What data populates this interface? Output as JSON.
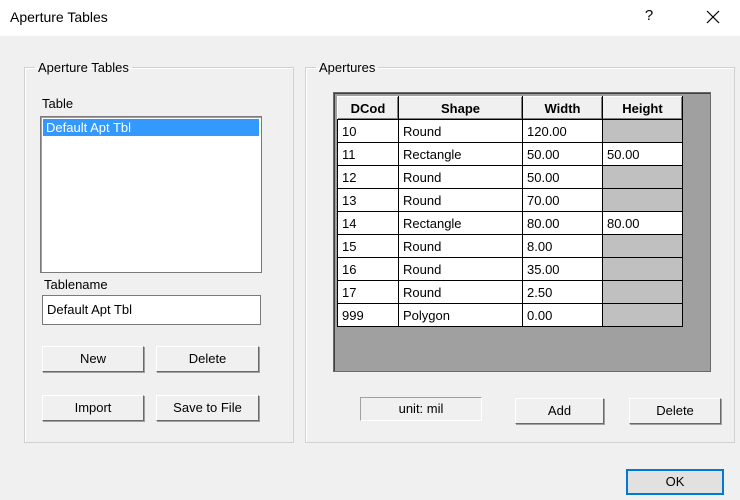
{
  "window": {
    "title": "Aperture Tables",
    "help_glyph": "?"
  },
  "left_group": {
    "legend": "Aperture Tables",
    "table_label": "Table",
    "tables": [
      "Default Apt Tbl"
    ],
    "tablename_label": "Tablename",
    "tablename_value": "Default Apt Tbl",
    "buttons": {
      "new": "New",
      "delete": "Delete",
      "import": "Import",
      "save": "Save to File"
    }
  },
  "right_group": {
    "legend": "Apertures",
    "columns": [
      "DCod",
      "Shape",
      "Width",
      "Height"
    ],
    "rows": [
      {
        "dcod": "10",
        "shape": "Round",
        "width": "120.00",
        "height": ""
      },
      {
        "dcod": "11",
        "shape": "Rectangle",
        "width": "50.00",
        "height": "50.00"
      },
      {
        "dcod": "12",
        "shape": "Round",
        "width": "50.00",
        "height": ""
      },
      {
        "dcod": "13",
        "shape": "Round",
        "width": "70.00",
        "height": ""
      },
      {
        "dcod": "14",
        "shape": "Rectangle",
        "width": "80.00",
        "height": "80.00"
      },
      {
        "dcod": "15",
        "shape": "Round",
        "width": "8.00",
        "height": ""
      },
      {
        "dcod": "16",
        "shape": "Round",
        "width": "35.00",
        "height": ""
      },
      {
        "dcod": "17",
        "shape": "Round",
        "width": "2.50",
        "height": ""
      },
      {
        "dcod": "999",
        "shape": " Polygon",
        "width": "0.00",
        "height": ""
      }
    ],
    "unit": "unit: mil",
    "buttons": {
      "add": "Add",
      "delete": "Delete"
    }
  },
  "footer": {
    "ok": "OK"
  },
  "colors": {
    "selection": "#3399ff",
    "disabled_cell": "#c0c0c0",
    "default_button_border": "#0078d7"
  }
}
